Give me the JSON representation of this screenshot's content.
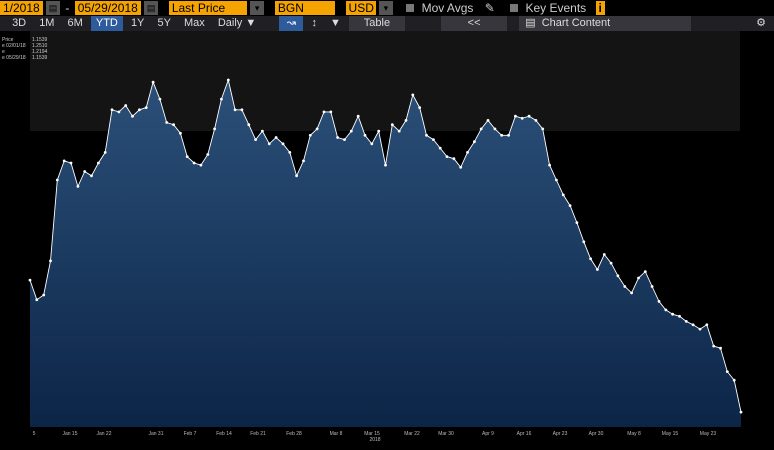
{
  "toolbar": {
    "date_start": "1/2018",
    "date_sep": "-",
    "date_end": "05/29/2018",
    "field": "Last Price",
    "source": "BGN",
    "currency": "USD",
    "mov_avgs": "Mov Avgs",
    "key_events": "Key Events",
    "key_events_badge": "i",
    "ranges": [
      "3D",
      "1M",
      "6M",
      "YTD",
      "1Y",
      "5Y",
      "Max"
    ],
    "selected_range": "YTD",
    "frequency": "Daily",
    "table": "Table",
    "collapse": "<<",
    "chart_content": "Chart Content"
  },
  "legend": {
    "rows": [
      {
        "label": "Price",
        "value": "1.1539"
      },
      {
        "label": "e 02/01/18",
        "value": "1.2510"
      },
      {
        "label": "e",
        "value": "1.2194"
      },
      {
        "label": "e 05/29/18",
        "value": "1.1539"
      }
    ]
  },
  "chart_data": {
    "type": "area",
    "x_tick_labels": [
      "5",
      "Jan 15",
      "Jan 22",
      "Jan 31",
      "Feb 7",
      "Feb 14",
      "Feb 21",
      "Feb 28",
      "Mar 8",
      "Mar 15",
      "Mar 22",
      "Mar 30",
      "Apr 9",
      "Apr 16",
      "Apr 23",
      "Apr 30",
      "May 8",
      "May 15",
      "May 23"
    ],
    "x_year_label": "2018",
    "colors": {
      "fill_top": "#2b5079",
      "fill_bottom": "#0c2547",
      "line": "#ffffff",
      "points": "#ffffff",
      "bg": "#000000",
      "band": "#141414"
    },
    "series": [
      {
        "values": [
          1.1935,
          1.1889,
          1.19,
          1.198,
          1.217,
          1.2215,
          1.221,
          1.2155,
          1.219,
          1.218,
          1.221,
          1.2235,
          1.2335,
          1.233,
          1.2345,
          1.232,
          1.2335,
          1.234,
          1.24,
          1.236,
          1.2305,
          1.23,
          1.228,
          1.2225,
          1.221,
          1.2205,
          1.223,
          1.229,
          1.236,
          1.2405,
          1.2335,
          1.2335,
          1.23,
          1.2265,
          1.2285,
          1.2255,
          1.227,
          1.2255,
          1.2235,
          1.218,
          1.2215,
          1.2275,
          1.229,
          1.233,
          1.233,
          1.227,
          1.2265,
          1.2285,
          1.232,
          1.2275,
          1.2255,
          1.2285,
          1.2205,
          1.23,
          1.2285,
          1.231,
          1.237,
          1.234,
          1.2275,
          1.2265,
          1.2245,
          1.2225,
          1.222,
          1.22,
          1.2235,
          1.226,
          1.229,
          1.231,
          1.229,
          1.2275,
          1.2275,
          1.232,
          1.2315,
          1.232,
          1.231,
          1.229,
          1.2205,
          1.217,
          1.2135,
          1.211,
          1.207,
          1.2025,
          1.1985,
          1.196,
          1.1995,
          1.1975,
          1.1945,
          1.192,
          1.1905,
          1.194,
          1.1955,
          1.192,
          1.1885,
          1.1865,
          1.1855,
          1.185,
          1.1838,
          1.183,
          1.182,
          1.183,
          1.178,
          1.1775,
          1.172,
          1.17,
          1.1625
        ]
      }
    ],
    "ylim": [
      1.159,
      1.252
    ],
    "grid": false
  }
}
